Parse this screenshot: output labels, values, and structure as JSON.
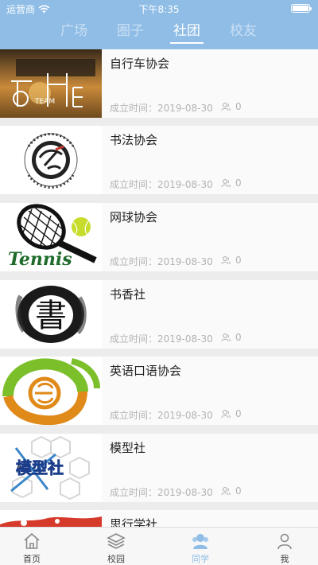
{
  "status_bar": {
    "carrier": "运营商",
    "time": "下午8:35"
  },
  "top_tabs": [
    {
      "label": "广场",
      "active": false
    },
    {
      "label": "圈子",
      "active": false
    },
    {
      "label": "社团",
      "active": true
    },
    {
      "label": "校友",
      "active": false
    }
  ],
  "clubs": [
    {
      "name": "自行车协会",
      "founded": "成立时间：2019-08-30",
      "members": "0",
      "thumb_text": "TEAM"
    },
    {
      "name": "书法协会",
      "founded": "成立时间：2019-08-30",
      "members": "0",
      "thumb_text": ""
    },
    {
      "name": "网球协会",
      "founded": "成立时间：2019-08-30",
      "members": "0",
      "thumb_text": "Tennis"
    },
    {
      "name": "书香社",
      "founded": "成立时间：2019-08-30",
      "members": "0",
      "thumb_text": "書"
    },
    {
      "name": "英语口语协会",
      "founded": "成立时间：2019-08-30",
      "members": "0",
      "thumb_text": ""
    },
    {
      "name": "模型社",
      "founded": "成立时间：2019-08-30",
      "members": "0",
      "thumb_text": "模型社"
    },
    {
      "name": "思行学社",
      "founded": "",
      "members": "",
      "thumb_text": ""
    }
  ],
  "bottom_nav": [
    {
      "label": "首页",
      "icon": "home-icon",
      "active": false
    },
    {
      "label": "校园",
      "icon": "layers-icon",
      "active": false
    },
    {
      "label": "同学",
      "icon": "classmates-icon",
      "active": true
    },
    {
      "label": "我",
      "icon": "person-icon",
      "active": false
    }
  ],
  "colors": {
    "header": "#8fbde6",
    "active_nav": "#8fbde6"
  }
}
